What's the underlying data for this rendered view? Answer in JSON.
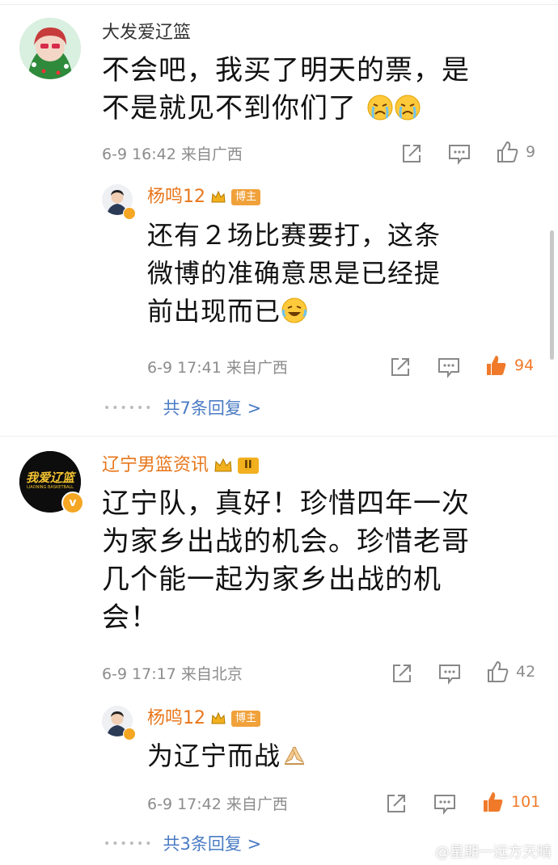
{
  "comments": [
    {
      "username": "大发爱辽篮",
      "text_lines": [
        "不会吧，我买了明天的票，是",
        "不是就见不到你们了"
      ],
      "meta": "6-9 16:42 来自广西",
      "likes": "9",
      "emoji": "crying-face-icon",
      "reply": {
        "username": "杨鸣12",
        "badge": "博主",
        "text_lines": [
          "还有２场比赛要打，这条",
          "微博的准确意思是已经提",
          "前出现而已"
        ],
        "meta": "6-9 17:41 来自广西",
        "likes": "94",
        "more": "共7条回复 >"
      }
    },
    {
      "username": "辽宁男篮资讯",
      "level_badge": "II",
      "avatar_text": "我爱辽篮",
      "avatar_subtext": "LIAONING BASKETBALL",
      "text_lines": [
        "辽宁队，真好！珍惜四年一次",
        "为家乡出战的机会。珍惜老哥",
        "几个能一起为家乡出战的机",
        "会！"
      ],
      "meta": "6-9 17:17 来自北京",
      "likes": "42",
      "reply": {
        "username": "杨鸣12",
        "badge": "博主",
        "text_lines": [
          "为辽宁而战"
        ],
        "meta": "6-9 17:42 来自广西",
        "likes": "101",
        "more": "共3条回复 >"
      }
    }
  ],
  "watermark": "@星期一远方天晴",
  "colors": {
    "accent_orange": "#e8761b",
    "link_blue": "#4a7bc4",
    "meta_gray": "#8c8c8c"
  }
}
